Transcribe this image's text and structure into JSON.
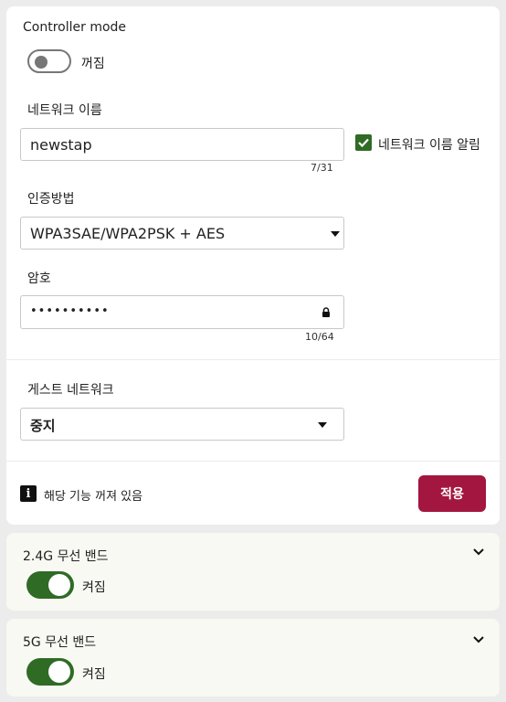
{
  "controller": {
    "label": "Controller mode",
    "state": "꺼짐",
    "enabled": false
  },
  "network_name": {
    "label": "네트워크 이름",
    "value": "newstap",
    "counter": "7/31",
    "broadcast_label": "네트워크 이름 알림",
    "broadcast_checked": true
  },
  "auth": {
    "label": "인증방법",
    "selected": "WPA3SAE/WPA2PSK + AES"
  },
  "password": {
    "label": "암호",
    "masked_value": "••••••••••",
    "counter": "10/64"
  },
  "guest": {
    "label": "게스트 네트워크",
    "selected": "중지"
  },
  "footer": {
    "info_text": "해당 기능 꺼져 있음",
    "apply_label": "적용"
  },
  "band_24": {
    "title": "2.4G 무선 밴드",
    "state": "켜짐",
    "enabled": true
  },
  "band_5": {
    "title": "5G 무선 밴드",
    "state": "켜짐",
    "enabled": true
  },
  "colors": {
    "accent": "#a3163f",
    "toggle_on": "#2f6b25",
    "checkbox": "#2f6b25"
  }
}
